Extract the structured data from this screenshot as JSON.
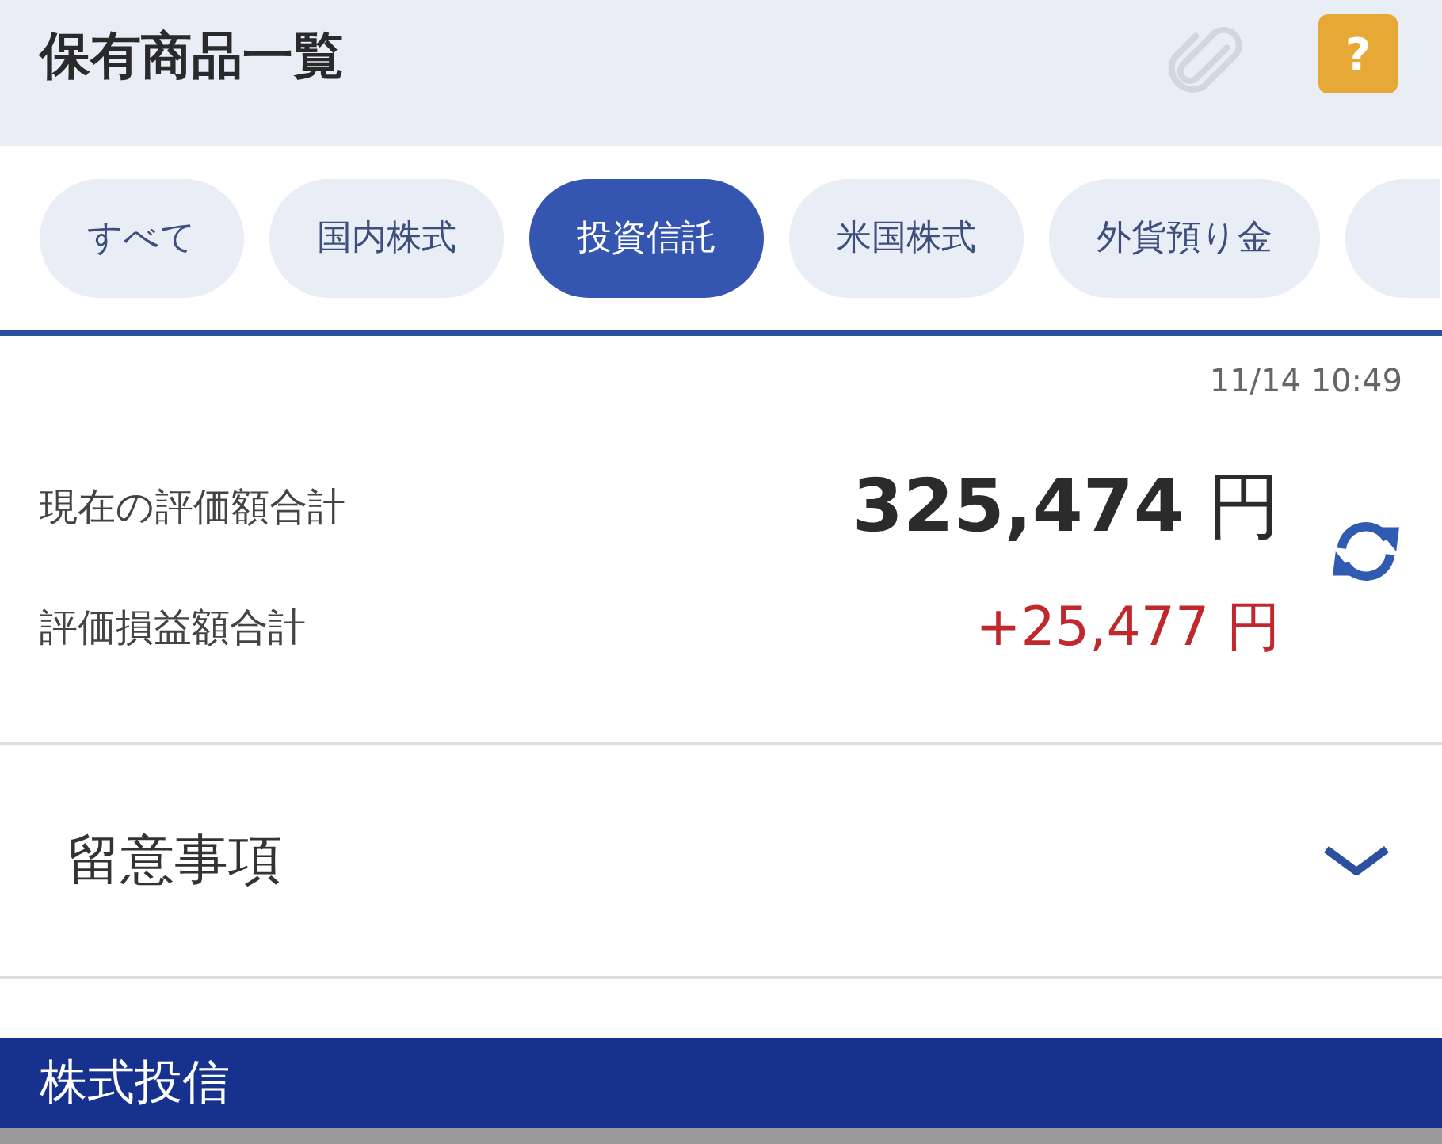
{
  "header": {
    "title": "保有商品一覧",
    "help_button": "?"
  },
  "tabs": [
    {
      "label": "すべて",
      "selected": false
    },
    {
      "label": "国内株式",
      "selected": false
    },
    {
      "label": "投資信託",
      "selected": true
    },
    {
      "label": "米国株式",
      "selected": false
    },
    {
      "label": "外貨預り金",
      "selected": false
    }
  ],
  "summary": {
    "timestamp": "11/14 10:49",
    "rows": [
      {
        "kind": "total",
        "label": "現在の評価額合計",
        "amount": "325,474",
        "unit": "円"
      },
      {
        "kind": "gain",
        "label": "評価損益額合計",
        "amount": "+25,477",
        "unit": "円"
      }
    ]
  },
  "notes": {
    "title": "留意事項",
    "expanded": false
  },
  "section": {
    "title": "株式投信"
  }
}
